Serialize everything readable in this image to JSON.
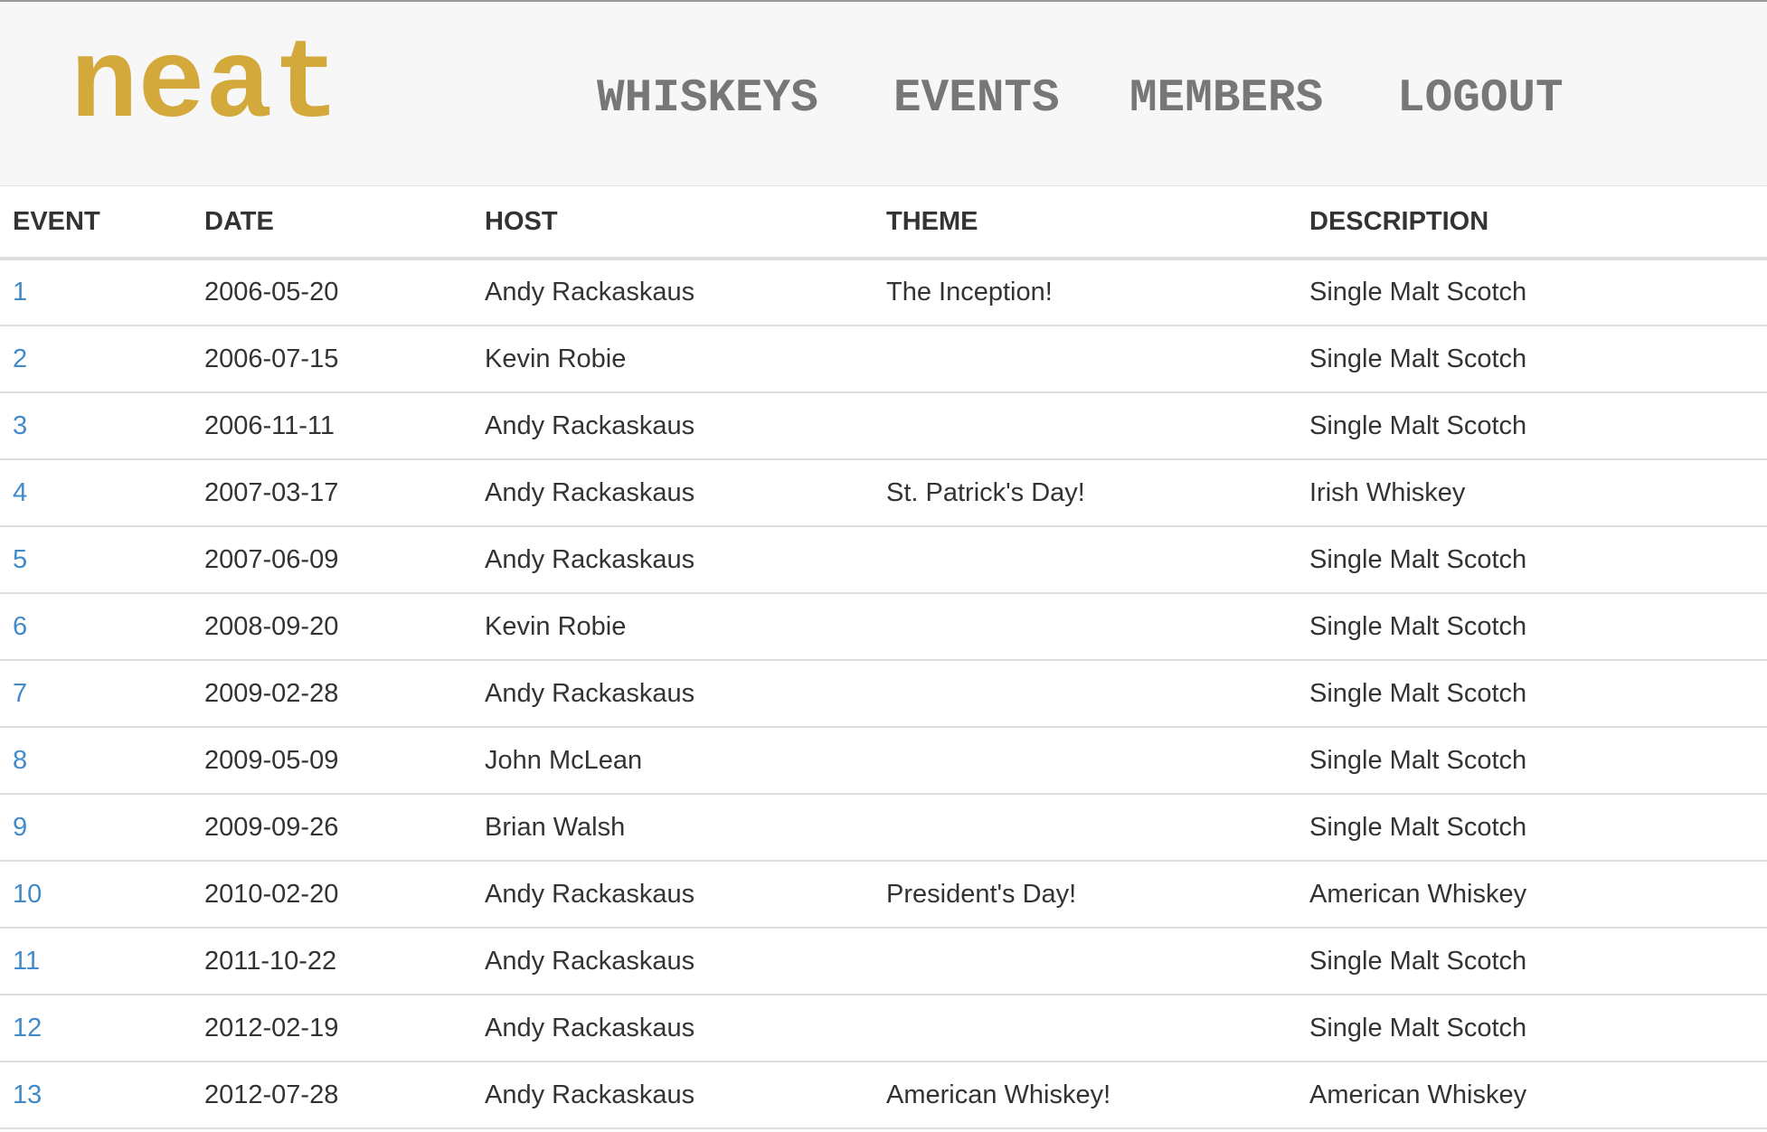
{
  "brand": "neat",
  "nav": [
    "WHISKEYS",
    "EVENTS",
    "MEMBERS",
    "LOGOUT"
  ],
  "colors": {
    "brand": "#d4a93c",
    "nav": "#777777",
    "link": "#428bca",
    "text": "#333333",
    "navbar_bg": "#f7f7f7"
  },
  "table": {
    "headers": [
      "EVENT",
      "DATE",
      "HOST",
      "THEME",
      "DESCRIPTION"
    ],
    "rows": [
      {
        "event": "1",
        "date": "2006-05-20",
        "host": "Andy Rackaskaus",
        "theme": "The Inception!",
        "description": "Single Malt Scotch"
      },
      {
        "event": "2",
        "date": "2006-07-15",
        "host": "Kevin Robie",
        "theme": "",
        "description": "Single Malt Scotch"
      },
      {
        "event": "3",
        "date": "2006-11-11",
        "host": "Andy Rackaskaus",
        "theme": "",
        "description": "Single Malt Scotch"
      },
      {
        "event": "4",
        "date": "2007-03-17",
        "host": "Andy Rackaskaus",
        "theme": "St. Patrick's Day!",
        "description": "Irish Whiskey"
      },
      {
        "event": "5",
        "date": "2007-06-09",
        "host": "Andy Rackaskaus",
        "theme": "",
        "description": "Single Malt Scotch"
      },
      {
        "event": "6",
        "date": "2008-09-20",
        "host": "Kevin Robie",
        "theme": "",
        "description": "Single Malt Scotch"
      },
      {
        "event": "7",
        "date": "2009-02-28",
        "host": "Andy Rackaskaus",
        "theme": "",
        "description": "Single Malt Scotch"
      },
      {
        "event": "8",
        "date": "2009-05-09",
        "host": "John McLean",
        "theme": "",
        "description": "Single Malt Scotch"
      },
      {
        "event": "9",
        "date": "2009-09-26",
        "host": "Brian Walsh",
        "theme": "",
        "description": "Single Malt Scotch"
      },
      {
        "event": "10",
        "date": "2010-02-20",
        "host": "Andy Rackaskaus",
        "theme": "President's Day!",
        "description": "American Whiskey"
      },
      {
        "event": "11",
        "date": "2011-10-22",
        "host": "Andy Rackaskaus",
        "theme": "",
        "description": "Single Malt Scotch"
      },
      {
        "event": "12",
        "date": "2012-02-19",
        "host": "Andy Rackaskaus",
        "theme": "",
        "description": "Single Malt Scotch"
      },
      {
        "event": "13",
        "date": "2012-07-28",
        "host": "Andy Rackaskaus",
        "theme": "American Whiskey!",
        "description": "American Whiskey"
      }
    ]
  }
}
